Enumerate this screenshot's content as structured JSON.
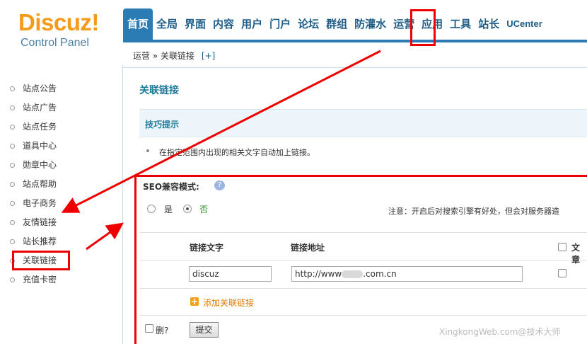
{
  "logo": {
    "main": "Discuz!",
    "sub": "Control Panel"
  },
  "nav": {
    "items": [
      {
        "label": "首页",
        "active": true
      },
      {
        "label": "全局"
      },
      {
        "label": "界面"
      },
      {
        "label": "内容"
      },
      {
        "label": "用户"
      },
      {
        "label": "门户"
      },
      {
        "label": "论坛"
      },
      {
        "label": "群组"
      },
      {
        "label": "防灌水"
      },
      {
        "label": "运营"
      },
      {
        "label": "应用"
      },
      {
        "label": "工具"
      },
      {
        "label": "站长"
      },
      {
        "label": "UCenter"
      }
    ]
  },
  "breadcrumb": {
    "section": "运营",
    "separator": "»",
    "current": "关联链接",
    "plus": "[+]"
  },
  "sidebar": {
    "items": [
      {
        "label": "站点公告"
      },
      {
        "label": "站点广告"
      },
      {
        "label": "站点任务"
      },
      {
        "label": "道具中心"
      },
      {
        "label": "勋章中心"
      },
      {
        "label": "站点帮助"
      },
      {
        "label": "电子商务"
      },
      {
        "label": "友情链接"
      },
      {
        "label": "站长推荐"
      },
      {
        "label": "关联链接"
      },
      {
        "label": "充值卡密"
      }
    ]
  },
  "main": {
    "title": "关联链接",
    "tips_title": "技巧提示",
    "tip_text": "在指定范围内出现的相关文字自动加上链接。",
    "seo_label": "SEO兼容模式:",
    "help_icon": "?",
    "radio_yes": "是",
    "radio_no": "否",
    "notice": "注意：开启后对搜索引擎有好处，但会对服务器造",
    "col_text": "链接文字",
    "col_url": "链接地址",
    "col_article": "文章",
    "row_text_value": "discuz",
    "row_url_prefix": "http://www",
    "row_url_suffix": ".com.cn",
    "add_label": "添加关联链接",
    "delete_label": "删?",
    "submit_label": "提交"
  },
  "watermark": "XingkongWeb.com@技术大师",
  "colors": {
    "accent": "#2b7cb4",
    "annotation": "#e00000",
    "logo": "#f59a1a"
  }
}
